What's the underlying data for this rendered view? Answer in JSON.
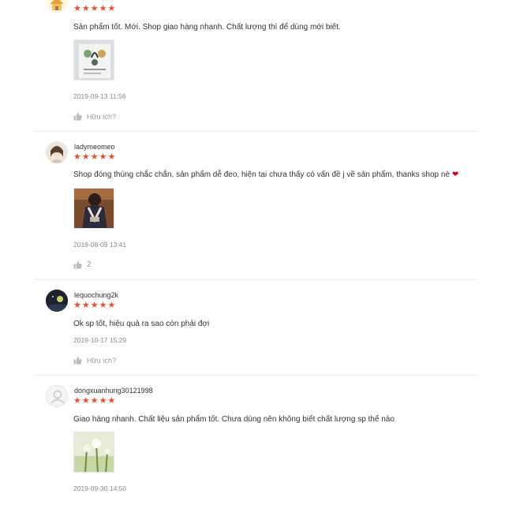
{
  "colors": {
    "star": "#ee4d2d",
    "heart": "#d0021b",
    "muted": "#999999"
  },
  "reviews": [
    {
      "username": "",
      "rating": 5,
      "comment": "Sản phẩm tốt. Mới. Shop giao hàng nhanh. Chất lượng thì để dùng mới biết.",
      "has_image": true,
      "timestamp": "2019-09-13 11:56",
      "helpful_label": "Hữu ích?"
    },
    {
      "username": "ladymeomeo",
      "rating": 5,
      "comment": "Shop đóng thùng chắc chắn, sản phẩm dễ đeo, hiện tại chưa thấy có vấn đề j về sản phẩm, thanks shop nè",
      "comment_emoji": "❤",
      "has_image": true,
      "timestamp": "2019-08-09 13:41",
      "helpful_label": "2"
    },
    {
      "username": "lequochung2k",
      "rating": 5,
      "comment": "Ok sp tốt, hiệu quả ra sao còn phải đợi",
      "has_image": false,
      "timestamp": "2019-10-17 15:29",
      "helpful_label": "Hữu ích?"
    },
    {
      "username": "dongxuanhung30121998",
      "rating": 5,
      "comment": "Giao hàng nhanh. Chất liệu sản phẩm tốt. Chưa dùng nên không biết chất lượng sp thế nào",
      "has_image": true,
      "timestamp": "2019-09-30 14:50",
      "helpful_label": ""
    }
  ]
}
